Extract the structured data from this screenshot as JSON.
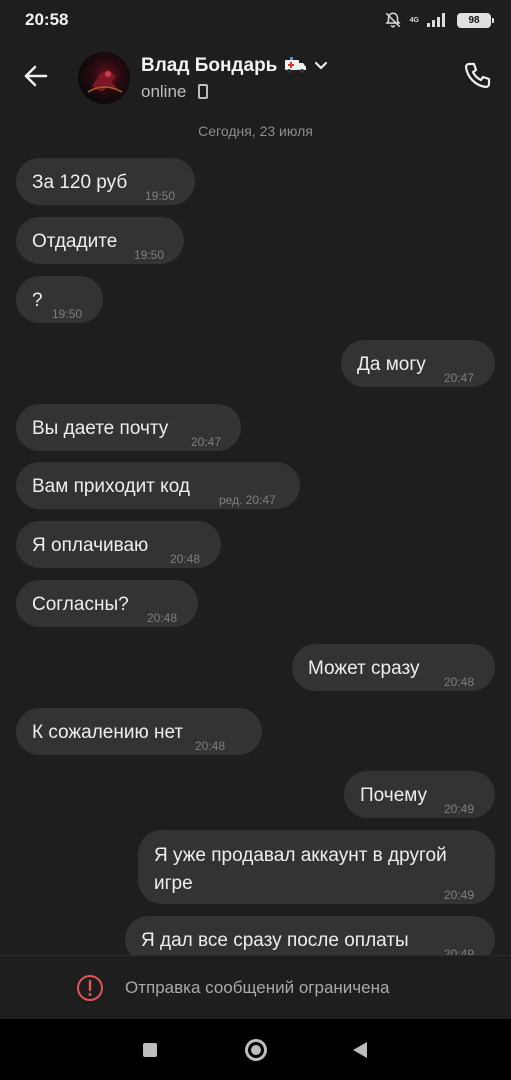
{
  "status_bar": {
    "time": "20:58",
    "network": "4G",
    "battery": "98"
  },
  "header": {
    "name": "Влад Бондарь",
    "presence": "online"
  },
  "chat": {
    "date_separator": "Сегодня, 23 июля",
    "messages": [
      {
        "side": "in",
        "text": "За 120 руб",
        "time": "19:50"
      },
      {
        "side": "in",
        "text": "Отдадите",
        "time": "19:50"
      },
      {
        "side": "in",
        "text": "?",
        "time": "19:50"
      },
      {
        "side": "out",
        "text": "Да могу",
        "time": "20:47"
      },
      {
        "side": "in",
        "text": "Вы даете почту",
        "time": "20:47"
      },
      {
        "side": "in",
        "text": "Вам приходит код",
        "time": "ред. 20:47"
      },
      {
        "side": "in",
        "text": "Я оплачиваю",
        "time": "20:48"
      },
      {
        "side": "in",
        "text": "Согласны?",
        "time": "20:48"
      },
      {
        "side": "out",
        "text": "Может сразу",
        "time": "20:48"
      },
      {
        "side": "in",
        "text": "К сожалению нет",
        "time": "20:48"
      },
      {
        "side": "out",
        "text": "Почему",
        "time": "20:49"
      },
      {
        "side": "out",
        "text": "Я уже продавал аккаунт в другой игре",
        "time": "20:49"
      },
      {
        "side": "out",
        "text": "Я дал все сразу после оплаты",
        "time": "20:49"
      }
    ]
  },
  "restriction": {
    "text": "Отправка сообщений ограничена"
  },
  "colors": {
    "background": "#1e1e1e",
    "bubble": "#333333",
    "alert": "#e05555"
  }
}
